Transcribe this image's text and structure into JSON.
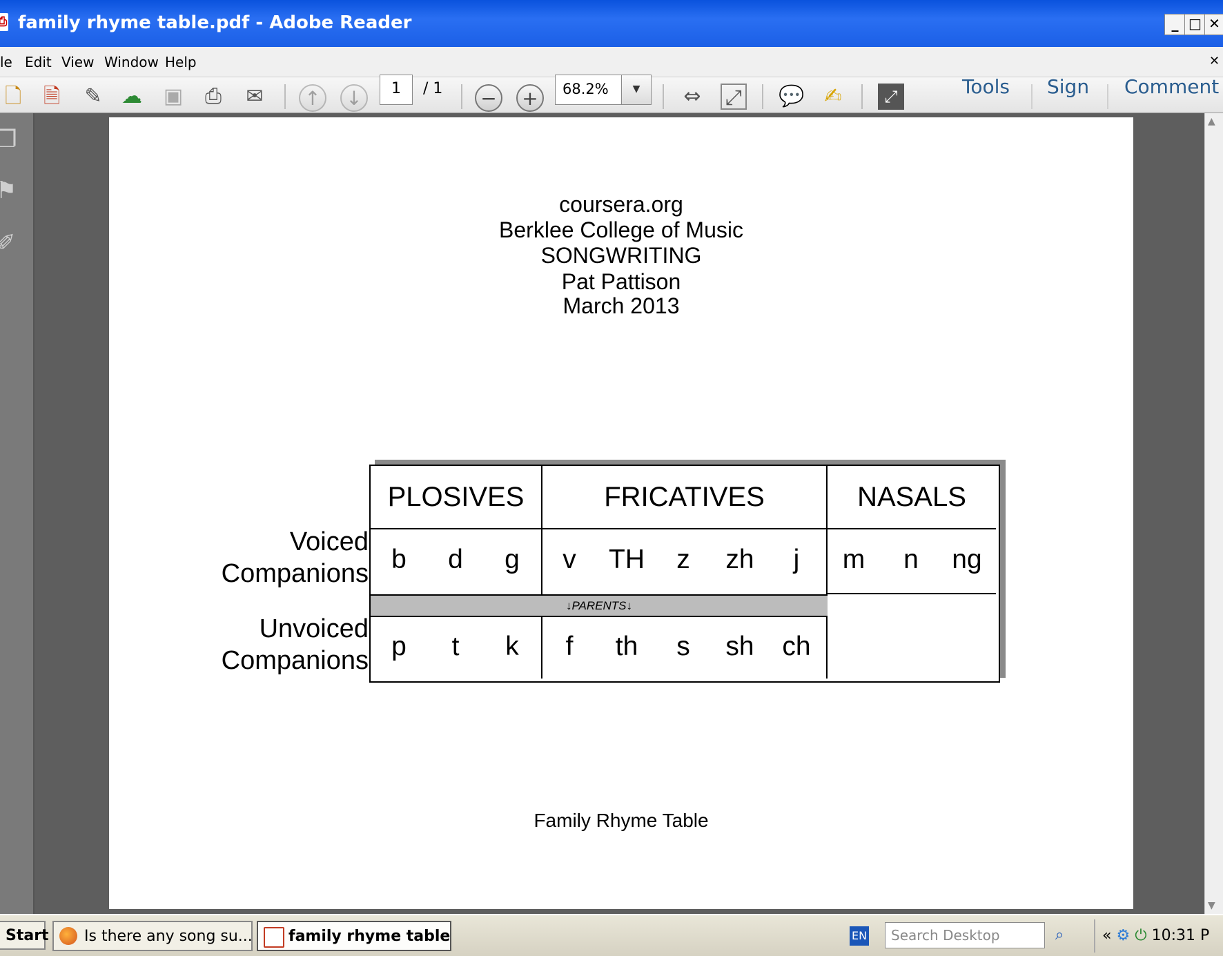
{
  "window": {
    "title": "family rhyme table.pdf - Adobe Reader",
    "minimize": "_",
    "maximize": "□",
    "close": "✕",
    "doc_close": "✕"
  },
  "menu": [
    "le",
    "Edit",
    "View",
    "Window",
    "Help"
  ],
  "toolbar": {
    "page_current": "1",
    "page_total": "/ 1",
    "zoom": "68.2%",
    "tools": "Tools",
    "sign": "Sign",
    "comment": "Comment"
  },
  "document": {
    "header_lines": [
      "coursera.org",
      "Berklee College of Music",
      "SONGWRITING",
      "Pat Pattison",
      "March 2013"
    ],
    "row_labels": {
      "voiced_1": "Voiced",
      "voiced_2": "Companions",
      "unvoiced_1": "Unvoiced",
      "unvoiced_2": "Companions"
    },
    "groups": [
      "PLOSIVES",
      "FRICATIVES",
      "NASALS"
    ],
    "voiced": {
      "plosives": [
        "b",
        "d",
        "g"
      ],
      "fricatives": [
        "v",
        "TH",
        "z",
        "zh",
        "j"
      ],
      "nasals": [
        "m",
        "n",
        "ng"
      ]
    },
    "parents_label": "↓PARENTS↓",
    "unvoiced": {
      "plosives": [
        "p",
        "t",
        "k"
      ],
      "fricatives": [
        "f",
        "th",
        "s",
        "sh",
        "ch"
      ]
    },
    "caption": "Family Rhyme Table"
  },
  "taskbar": {
    "start": "Start",
    "tasks": [
      "Is there any song su...",
      "family rhyme table..."
    ],
    "lang": "EN",
    "search_placeholder": "Search Desktop",
    "tray_chevron": "«",
    "clock": "10:31 P"
  },
  "colors": {
    "titlebar": "#0a52dd",
    "accent_text": "#2a5d8f",
    "doc_bg": "#5e5e5e",
    "parents_band": "#bcbcbc"
  }
}
